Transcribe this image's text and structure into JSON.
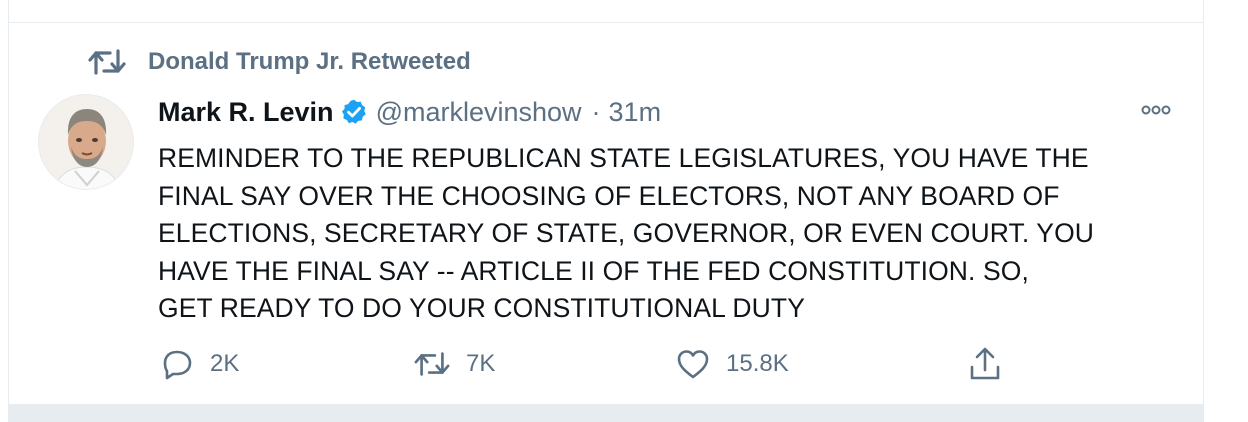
{
  "retweet": {
    "icon": "retweet-icon",
    "text": "Donald Trump Jr. Retweeted"
  },
  "tweet": {
    "author": {
      "name": "Mark R. Levin",
      "handle": "@marklevinshow",
      "verified": true
    },
    "separator": "·",
    "time": "31m",
    "lines": [
      "REMINDER TO THE REPUBLICAN STATE LEGISLATURES, YOU HAVE THE",
      "FINAL SAY OVER THE CHOOSING OF ELECTORS, NOT ANY BOARD OF",
      "ELECTIONS, SECRETARY OF STATE, GOVERNOR, OR EVEN COURT. YOU",
      "HAVE THE FINAL SAY -- ARTICLE II OF THE FED CONSTITUTION. SO,",
      "GET READY TO DO YOUR CONSTITUTIONAL DUTY"
    ],
    "actions": {
      "reply": {
        "icon": "reply-icon",
        "count": "2K"
      },
      "retweet": {
        "icon": "retweet-icon",
        "count": "7K"
      },
      "like": {
        "icon": "heart-icon",
        "count": "15.8K"
      },
      "share": {
        "icon": "share-icon"
      }
    }
  },
  "colors": {
    "text": "#0f1419",
    "secondary": "#5b7083",
    "verified": "#1da1f2",
    "divider": "#e6ecf0"
  }
}
